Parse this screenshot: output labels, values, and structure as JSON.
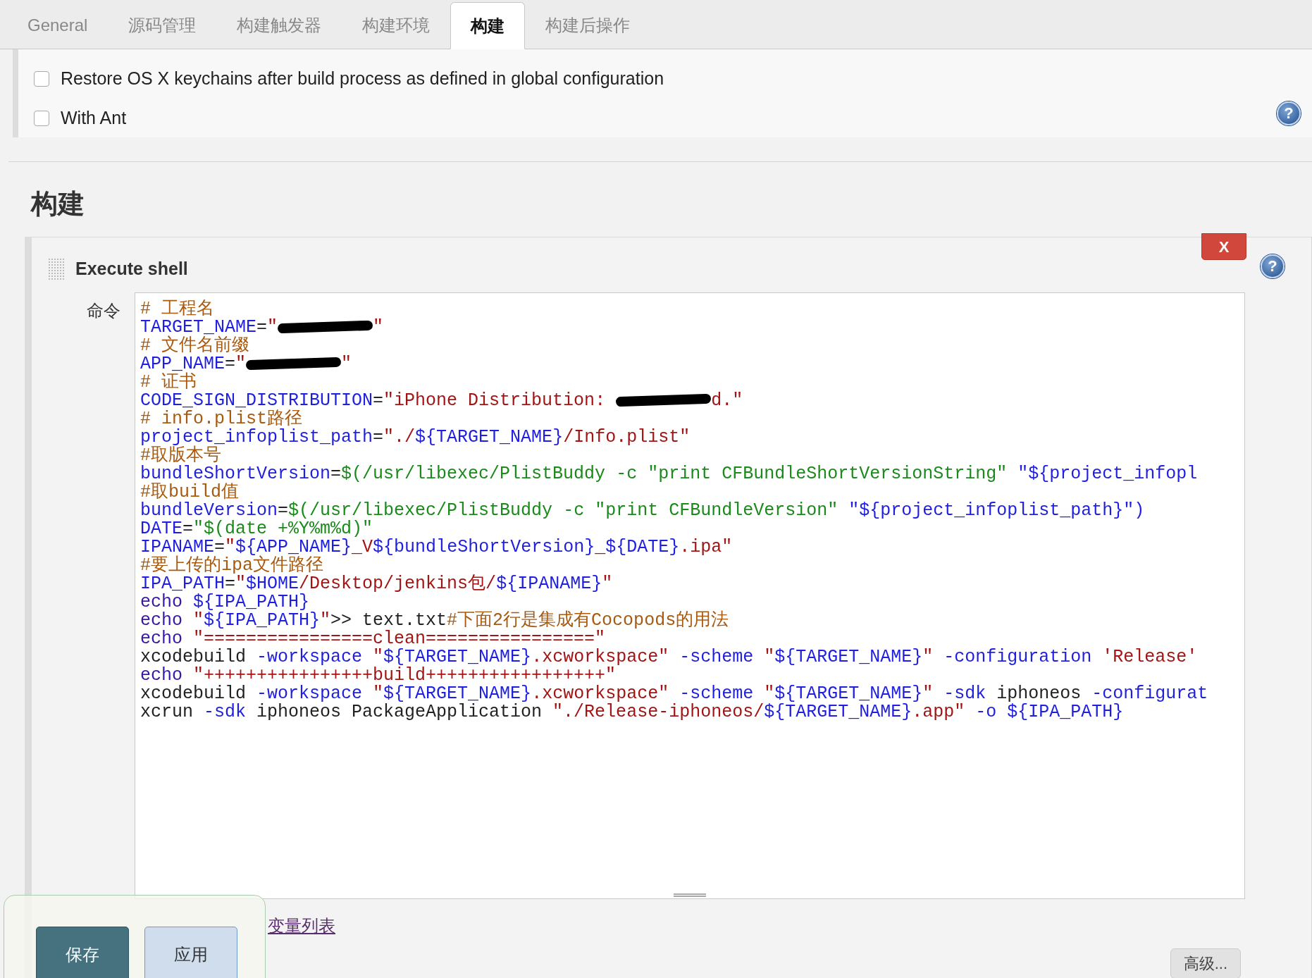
{
  "tabs": [
    {
      "label": "General",
      "selected": false
    },
    {
      "label": "源码管理",
      "selected": false
    },
    {
      "label": "构建触发器",
      "selected": false
    },
    {
      "label": "构建环境",
      "selected": false
    },
    {
      "label": "构建",
      "selected": true
    },
    {
      "label": "构建后操作",
      "selected": false
    }
  ],
  "options": [
    {
      "label": "Restore OS X keychains after build process as defined in global configuration",
      "checked": false
    },
    {
      "label": "With Ant",
      "checked": false
    }
  ],
  "options_help": "?",
  "section_title": "构建",
  "build_step": {
    "title": "Execute shell",
    "delete_label": "X",
    "help": "?",
    "command_label": "命令",
    "command_lines": [
      [
        {
          "kind": "comment",
          "text": "# 工程名"
        }
      ],
      [
        {
          "kind": "var",
          "text": "TARGET_NAME"
        },
        {
          "kind": "plain",
          "text": "="
        },
        {
          "kind": "string",
          "text": "\""
        },
        {
          "kind": "redaction"
        },
        {
          "kind": "string",
          "text": "\""
        }
      ],
      [
        {
          "kind": "comment",
          "text": "# 文件名前缀"
        }
      ],
      [
        {
          "kind": "var",
          "text": "APP_NAME"
        },
        {
          "kind": "plain",
          "text": "="
        },
        {
          "kind": "string",
          "text": "\""
        },
        {
          "kind": "redaction"
        },
        {
          "kind": "string",
          "text": "\""
        }
      ],
      [
        {
          "kind": "comment",
          "text": "# 证书"
        }
      ],
      [
        {
          "kind": "var",
          "text": "CODE_SIGN_DISTRIBUTION"
        },
        {
          "kind": "plain",
          "text": "="
        },
        {
          "kind": "string",
          "text": "\"iPhone Distribution: "
        },
        {
          "kind": "redaction"
        },
        {
          "kind": "string",
          "text": "d.\""
        }
      ],
      [
        {
          "kind": "comment",
          "text": "# info.plist路径"
        }
      ],
      [
        {
          "kind": "var",
          "text": "project_infoplist_path"
        },
        {
          "kind": "plain",
          "text": "="
        },
        {
          "kind": "string",
          "text": "\"./"
        },
        {
          "kind": "var",
          "text": "${TARGET_NAME}"
        },
        {
          "kind": "string",
          "text": "/Info.plist\""
        }
      ],
      [
        {
          "kind": "comment",
          "text": "#取版本号"
        }
      ],
      [
        {
          "kind": "var",
          "text": "bundleShortVersion"
        },
        {
          "kind": "plain",
          "text": "="
        },
        {
          "kind": "command",
          "text": "$(/usr/libexec/PlistBuddy -c \"print CFBundleShortVersionString\" "
        },
        {
          "kind": "var",
          "text": "\"${project_infopl"
        }
      ],
      [
        {
          "kind": "comment",
          "text": "#取build值"
        }
      ],
      [
        {
          "kind": "var",
          "text": "bundleVersion"
        },
        {
          "kind": "plain",
          "text": "="
        },
        {
          "kind": "command",
          "text": "$(/usr/libexec/PlistBuddy -c \"print CFBundleVersion\" "
        },
        {
          "kind": "var",
          "text": "\"${project_infoplist_path}\")"
        }
      ],
      [
        {
          "kind": "var",
          "text": "DATE"
        },
        {
          "kind": "plain",
          "text": "="
        },
        {
          "kind": "command",
          "text": "\"$(date +%Y%m%d)\""
        }
      ],
      [
        {
          "kind": "var",
          "text": "IPANAME"
        },
        {
          "kind": "plain",
          "text": "="
        },
        {
          "kind": "string",
          "text": "\""
        },
        {
          "kind": "var",
          "text": "${APP_NAME}"
        },
        {
          "kind": "string",
          "text": "_V"
        },
        {
          "kind": "var",
          "text": "${bundleShortVersion}"
        },
        {
          "kind": "string",
          "text": "_"
        },
        {
          "kind": "var",
          "text": "${DATE}"
        },
        {
          "kind": "string",
          "text": ".ipa\""
        }
      ],
      [
        {
          "kind": "comment",
          "text": "#要上传的ipa文件路径"
        }
      ],
      [
        {
          "kind": "var",
          "text": "IPA_PATH"
        },
        {
          "kind": "plain",
          "text": "="
        },
        {
          "kind": "string",
          "text": "\""
        },
        {
          "kind": "var",
          "text": "$HOME"
        },
        {
          "kind": "string",
          "text": "/Desktop/jenkins包/"
        },
        {
          "kind": "var",
          "text": "${IPANAME}"
        },
        {
          "kind": "string",
          "text": "\""
        }
      ],
      [
        {
          "kind": "keyword",
          "text": "echo "
        },
        {
          "kind": "var",
          "text": "${IPA_PATH}"
        }
      ],
      [
        {
          "kind": "keyword",
          "text": "echo "
        },
        {
          "kind": "string",
          "text": "\""
        },
        {
          "kind": "var",
          "text": "${IPA_PATH}"
        },
        {
          "kind": "string",
          "text": "\""
        },
        {
          "kind": "plain",
          "text": ">> text.txt"
        },
        {
          "kind": "comment",
          "text": "#下面2行是集成有Cocopods的用法"
        }
      ],
      [
        {
          "kind": "keyword",
          "text": "echo "
        },
        {
          "kind": "string",
          "text": "\"================clean================\""
        }
      ],
      [
        {
          "kind": "plain",
          "text": "xcodebuild "
        },
        {
          "kind": "var",
          "text": "-workspace "
        },
        {
          "kind": "string",
          "text": "\""
        },
        {
          "kind": "var",
          "text": "${TARGET_NAME}"
        },
        {
          "kind": "string",
          "text": ".xcworkspace\""
        },
        {
          "kind": "var",
          "text": " -scheme "
        },
        {
          "kind": "string",
          "text": "\""
        },
        {
          "kind": "var",
          "text": "${TARGET_NAME}"
        },
        {
          "kind": "string",
          "text": "\""
        },
        {
          "kind": "var",
          "text": " -configuration "
        },
        {
          "kind": "string",
          "text": "'Release'"
        }
      ],
      [
        {
          "kind": "keyword",
          "text": "echo "
        },
        {
          "kind": "string",
          "text": "\"++++++++++++++++build+++++++++++++++++\""
        }
      ],
      [
        {
          "kind": "plain",
          "text": "xcodebuild "
        },
        {
          "kind": "var",
          "text": "-workspace "
        },
        {
          "kind": "string",
          "text": "\""
        },
        {
          "kind": "var",
          "text": "${TARGET_NAME}"
        },
        {
          "kind": "string",
          "text": ".xcworkspace\""
        },
        {
          "kind": "var",
          "text": " -scheme "
        },
        {
          "kind": "string",
          "text": "\""
        },
        {
          "kind": "var",
          "text": "${TARGET_NAME}"
        },
        {
          "kind": "string",
          "text": "\""
        },
        {
          "kind": "var",
          "text": " -sdk "
        },
        {
          "kind": "plain",
          "text": "iphoneos "
        },
        {
          "kind": "var",
          "text": "-configurat"
        }
      ],
      [
        {
          "kind": "plain",
          "text": "xcrun "
        },
        {
          "kind": "var",
          "text": "-sdk "
        },
        {
          "kind": "plain",
          "text": "iphoneos PackageApplication "
        },
        {
          "kind": "string",
          "text": "\"./Release-iphoneos/"
        },
        {
          "kind": "var",
          "text": "${TARGET_NAME}"
        },
        {
          "kind": "string",
          "text": ".app\""
        },
        {
          "kind": "var",
          "text": " -o ${IPA_PATH}"
        }
      ]
    ]
  },
  "env_link": "变量列表",
  "advanced_button": "高级...",
  "actions": [
    "保存",
    "应用"
  ]
}
